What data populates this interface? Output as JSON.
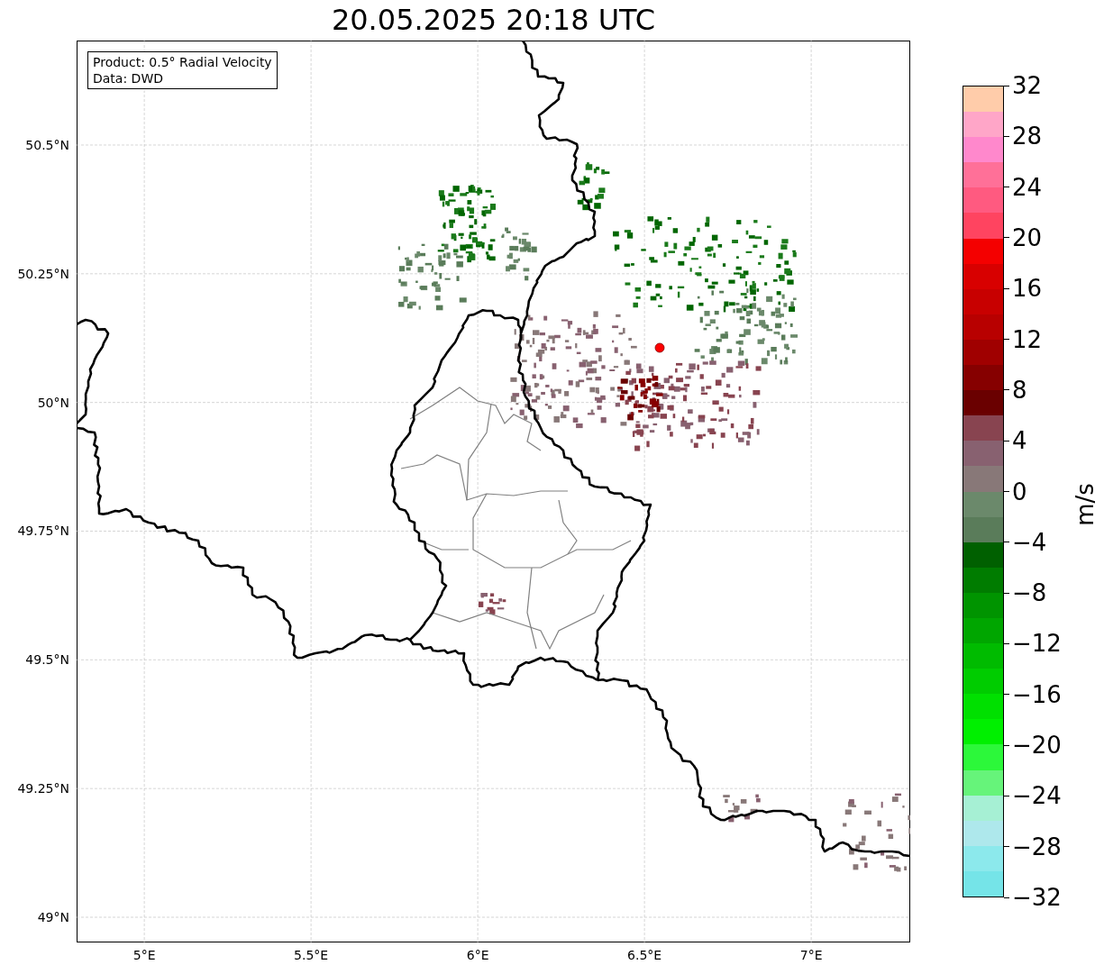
{
  "title": "20.05.2025 20:18 UTC",
  "info_box": {
    "lines": [
      "Product: 0.5° Radial Velocity",
      "Data: DWD"
    ]
  },
  "map": {
    "xticks": [
      "5°E",
      "5.5°E",
      "6°E",
      "6.5°E",
      "7°E"
    ],
    "yticks": [
      "50.5°N",
      "50.25°N",
      "50°N",
      "49.75°N",
      "49.5°N",
      "49.25°N",
      "49°N"
    ]
  },
  "colorbar": {
    "label": "m/s",
    "ticks": [
      "32",
      "28",
      "24",
      "20",
      "16",
      "12",
      "8",
      "4",
      "0",
      "−4",
      "−8",
      "−12",
      "−16",
      "−20",
      "−24",
      "−28",
      "−32"
    ],
    "bands": [
      {
        "color": "#75e4e8"
      },
      {
        "color": "#8ce9ec"
      },
      {
        "color": "#aee8ec"
      },
      {
        "color": "#a6f0d4"
      },
      {
        "color": "#66f47a"
      },
      {
        "color": "#2cf83a"
      },
      {
        "color": "#00f000"
      },
      {
        "color": "#00e000"
      },
      {
        "color": "#00cc00"
      },
      {
        "color": "#00bb00"
      },
      {
        "color": "#00a600"
      },
      {
        "color": "#009400"
      },
      {
        "color": "#007c00"
      },
      {
        "color": "#006000"
      },
      {
        "color": "#5a7c5a"
      },
      {
        "color": "#6b896b"
      },
      {
        "color": "#887878"
      },
      {
        "color": "#886170"
      },
      {
        "color": "#884450"
      },
      {
        "color": "#6a0000"
      },
      {
        "color": "#860000"
      },
      {
        "color": "#a00000"
      },
      {
        "color": "#b80000"
      },
      {
        "color": "#c80000"
      },
      {
        "color": "#d80000"
      },
      {
        "color": "#f40000"
      },
      {
        "color": "#ff4460"
      },
      {
        "color": "#ff5a80"
      },
      {
        "color": "#ff7098"
      },
      {
        "color": "#ff88cc"
      },
      {
        "color": "#ffa6c8"
      },
      {
        "color": "#ffccaa"
      }
    ]
  }
}
